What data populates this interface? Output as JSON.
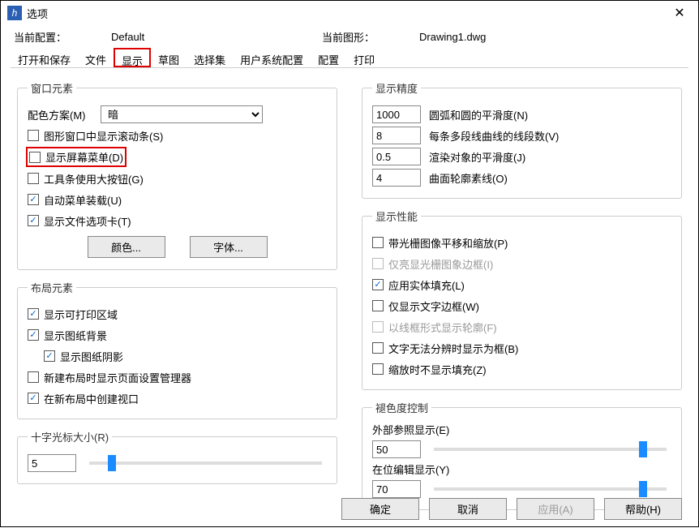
{
  "titlebar": {
    "title": "选项"
  },
  "config": {
    "current_config_label": "当前配置：",
    "current_config_value": "Default",
    "current_drawing_label": "当前图形：",
    "current_drawing_value": "Drawing1.dwg"
  },
  "tabs": {
    "open_save": "打开和保存",
    "file": "文件",
    "display": "显示",
    "sketch": "草图",
    "select_set": "选择集",
    "user_system": "用户系统配置",
    "config": "配置",
    "print": "打印"
  },
  "window_elements": {
    "legend": "窗口元素",
    "color_scheme_label": "配色方案(M)",
    "color_scheme_value": "暗",
    "scrollbars": "图形窗口中显示滚动条(S)",
    "screen_menu": "显示屏幕菜单(D)",
    "large_buttons": "工具条使用大按钮(G)",
    "auto_menu": "自动菜单装载(U)",
    "file_tabs": "显示文件选项卡(T)",
    "color_btn": "颜色...",
    "font_btn": "字体..."
  },
  "layout_elements": {
    "legend": "布局元素",
    "printable_area": "显示可打印区域",
    "paper_bg": "显示图纸背景",
    "paper_shadow": "显示图纸阴影",
    "page_setup_mgr": "新建布局时显示页面设置管理器",
    "create_viewport": "在新布局中创建视口"
  },
  "crosshair": {
    "legend": "十字光标大小(R)",
    "value": "5"
  },
  "display_precision": {
    "legend": "显示精度",
    "arc_smooth": {
      "value": "1000",
      "label": "圆弧和圆的平滑度(N)"
    },
    "polyline_segs": {
      "value": "8",
      "label": "每条多段线曲线的线段数(V)"
    },
    "render_smooth": {
      "value": "0.5",
      "label": "渲染对象的平滑度(J)"
    },
    "surface_contour": {
      "value": "4",
      "label": "曲面轮廓素线(O)"
    }
  },
  "display_perf": {
    "legend": "显示性能",
    "raster_pan": "带光栅图像平移和缩放(P)",
    "highlight_raster": "仅亮显光栅图象边框(I)",
    "solid_fill": "应用实体填充(L)",
    "text_frame": "仅显示文字边框(W)",
    "wireframe": "以线框形式显示轮廓(F)",
    "text_as_frame": "文字无法分辨时显示为框(B)",
    "no_fill_zoom": "缩放时不显示填充(Z)"
  },
  "fade": {
    "legend": "褪色度控制",
    "xref_label": "外部参照显示(E)",
    "xref_value": "50",
    "inplace_label": "在位编辑显示(Y)",
    "inplace_value": "70"
  },
  "footer": {
    "ok": "确定",
    "cancel": "取消",
    "apply": "应用(A)",
    "help": "帮助(H)"
  }
}
